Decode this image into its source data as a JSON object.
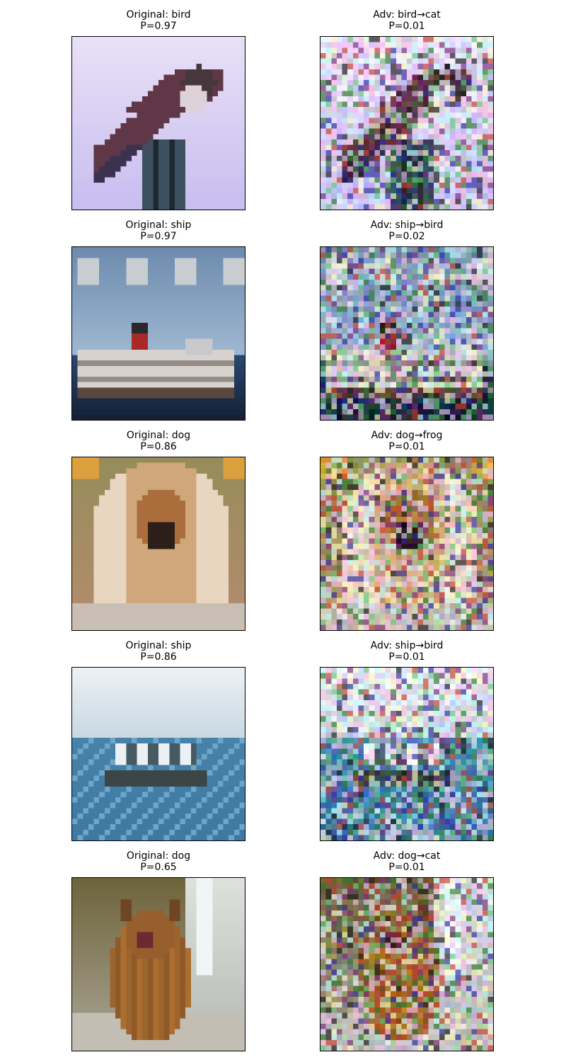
{
  "figure": {
    "rows": [
      {
        "original": {
          "line1": "Original: bird",
          "line2": "P=0.97",
          "scene": "bird-on-post"
        },
        "adversarial": {
          "line1": "Adv: bird→cat",
          "line2": "P=0.01",
          "scene": "bird-on-post"
        }
      },
      {
        "original": {
          "line1": "Original: ship",
          "line2": "P=0.97",
          "scene": "cruise-ship"
        },
        "adversarial": {
          "line1": "Adv: ship→bird",
          "line2": "P=0.02",
          "scene": "cruise-ship"
        }
      },
      {
        "original": {
          "line1": "Original: dog",
          "line2": "P=0.86",
          "scene": "long-haired-dog"
        },
        "adversarial": {
          "line1": "Adv: dog→frog",
          "line2": "P=0.01",
          "scene": "long-haired-dog"
        }
      },
      {
        "original": {
          "line1": "Original: ship",
          "line2": "P=0.86",
          "scene": "boat-at-sea"
        },
        "adversarial": {
          "line1": "Adv: ship→bird",
          "line2": "P=0.01",
          "scene": "boat-at-sea"
        }
      },
      {
        "original": {
          "line1": "Original: dog",
          "line2": "P=0.65",
          "scene": "sitting-dog"
        },
        "adversarial": {
          "line1": "Adv: dog→cat",
          "line2": "P=0.01",
          "scene": "sitting-dog"
        }
      }
    ]
  }
}
